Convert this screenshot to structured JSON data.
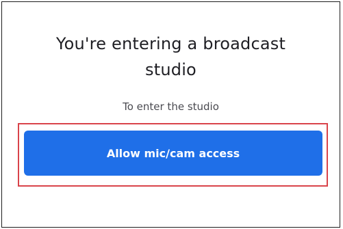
{
  "dialog": {
    "title_line1": "You're entering a broadcast",
    "title_line2": "studio",
    "subtitle": "To enter the studio",
    "allow_button_label": "Allow mic/cam access"
  },
  "colors": {
    "accent": "#1f6fe8",
    "highlight_border": "#d9434a",
    "frame_border": "#1a1a1a"
  }
}
